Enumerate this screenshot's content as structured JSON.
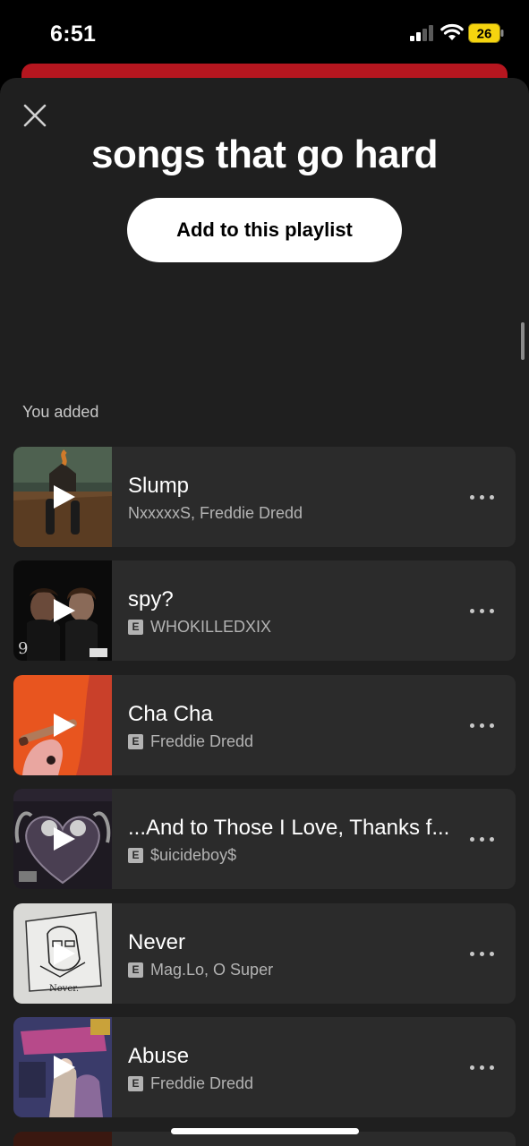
{
  "status_bar": {
    "time": "6:51",
    "battery": "26"
  },
  "sheet": {
    "title": "songs that go hard",
    "add_button_label": "Add to this playlist",
    "section_label": "You added"
  },
  "tracks": [
    {
      "title": "Slump",
      "artists": "NxxxxxS, Freddie Dredd",
      "explicit": false,
      "cover": "field-house-couple"
    },
    {
      "title": "spy?",
      "artists": "WHOKILLEDXIX",
      "explicit": true,
      "cover": "two-faces-dark"
    },
    {
      "title": "Cha Cha",
      "artists": "Freddie Dredd",
      "explicit": true,
      "cover": "hand-cigar-orange"
    },
    {
      "title": "...And to Those I Love, Thanks f...",
      "artists": "$uicideboy$",
      "explicit": true,
      "cover": "winged-heart-dark"
    },
    {
      "title": "Never",
      "artists": "Mag.Lo, O Super",
      "explicit": true,
      "cover": "sketch-face-paper"
    },
    {
      "title": "Abuse",
      "artists": "Freddie Dredd",
      "explicit": true,
      "cover": "variety-pack-collage"
    }
  ],
  "colors": {
    "sheet_bg": "#1f1f1f",
    "row_bg": "#2b2b2b",
    "header_strip": "#b5161f"
  }
}
